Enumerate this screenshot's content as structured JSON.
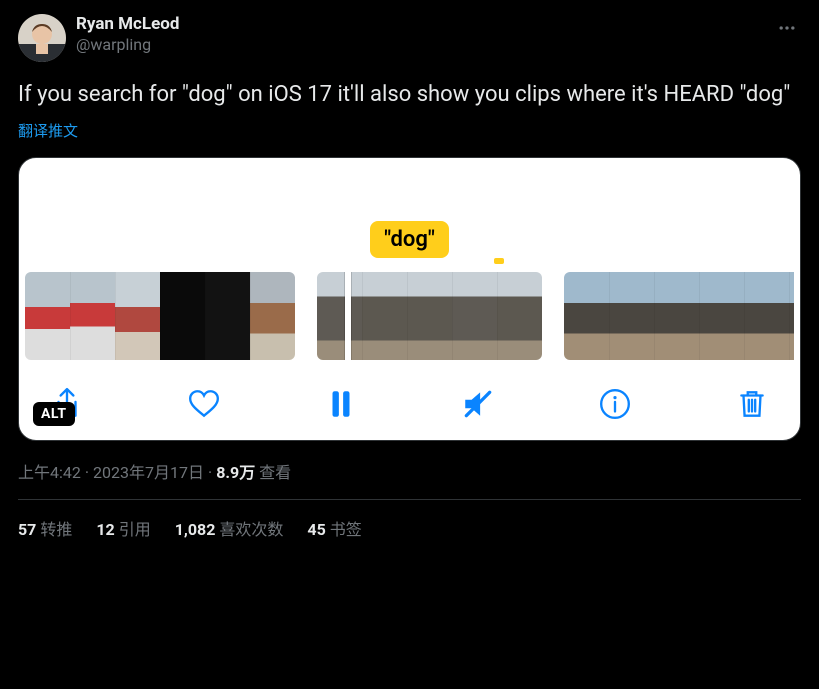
{
  "author": {
    "display_name": "Ryan McLeod",
    "handle": "@warpling"
  },
  "text": "If you search for \"dog\" on iOS 17 it'll also show you clips where it's HEARD \"dog\"",
  "translate_label": "翻译推文",
  "media": {
    "search_tag": "\"dog\"",
    "alt_badge": "ALT",
    "controls": {
      "share": "share",
      "like": "like",
      "pause": "pause",
      "mute": "mute",
      "info": "info",
      "delete": "delete"
    }
  },
  "meta": {
    "time": "上午4:42",
    "date": "2023年7月17日",
    "views_count": "8.9万",
    "views_label": "查看"
  },
  "stats": {
    "retweets": {
      "count": "57",
      "label": "转推"
    },
    "quotes": {
      "count": "12",
      "label": "引用"
    },
    "likes": {
      "count": "1,082",
      "label": "喜欢次数"
    },
    "bookmarks": {
      "count": "45",
      "label": "书签"
    }
  }
}
